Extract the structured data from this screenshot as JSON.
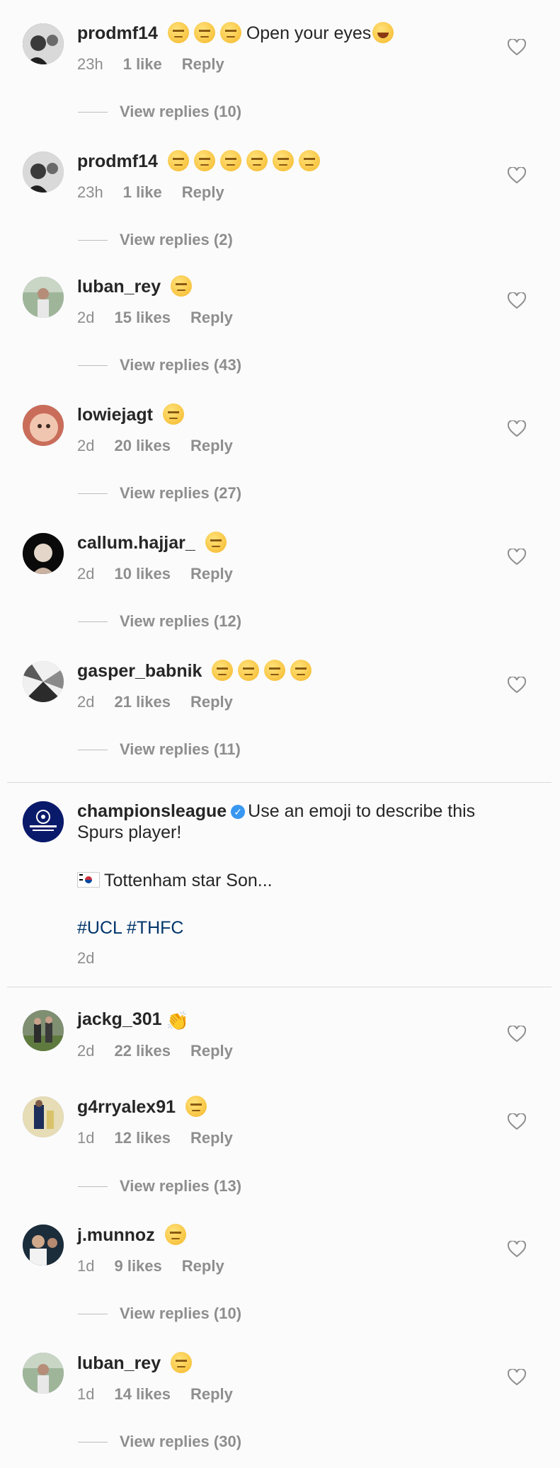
{
  "comments_top": [
    {
      "username": "prodmf14",
      "text": "Open your eyes",
      "emoji_count": 3,
      "extra": "laugh",
      "time": "23h",
      "likes": "1 like",
      "reply": "Reply",
      "view_replies": "View replies (10)"
    },
    {
      "username": "prodmf14",
      "text": "",
      "emoji_count": 6,
      "extra": "",
      "time": "23h",
      "likes": "1 like",
      "reply": "Reply",
      "view_replies": "View replies (2)"
    },
    {
      "username": "luban_rey",
      "text": "",
      "emoji_count": 1,
      "extra": "",
      "time": "2d",
      "likes": "15 likes",
      "reply": "Reply",
      "view_replies": "View replies (43)"
    },
    {
      "username": "lowiejagt",
      "text": "",
      "emoji_count": 1,
      "extra": "",
      "time": "2d",
      "likes": "20 likes",
      "reply": "Reply",
      "view_replies": "View replies (27)"
    },
    {
      "username": "callum.hajjar_",
      "text": "",
      "emoji_count": 1,
      "extra": "",
      "time": "2d",
      "likes": "10 likes",
      "reply": "Reply",
      "view_replies": "View replies (12)"
    },
    {
      "username": "gasper_babnik",
      "text": "",
      "emoji_count": 4,
      "extra": "",
      "time": "2d",
      "likes": "21 likes",
      "reply": "Reply",
      "view_replies": "View replies (11)"
    }
  ],
  "post": {
    "username": "championsleague",
    "caption_line1": "Use an emoji to describe this",
    "caption_line2": "Spurs player!",
    "caption_line3": "Tottenham star Son...",
    "hashtags": "#UCL #THFC",
    "time": "2d",
    "avatar_text": "CHAMPIONS LEAGUE"
  },
  "comments_bottom": [
    {
      "username": "jackg_301",
      "emoji": "clap",
      "emoji_count": 0,
      "time": "2d",
      "likes": "22 likes",
      "reply": "Reply",
      "view_replies": ""
    },
    {
      "username": "g4rryalex91",
      "emoji": "",
      "emoji_count": 1,
      "time": "1d",
      "likes": "12 likes",
      "reply": "Reply",
      "view_replies": "View replies (13)"
    },
    {
      "username": "j.munnoz",
      "emoji": "",
      "emoji_count": 1,
      "time": "1d",
      "likes": "9 likes",
      "reply": "Reply",
      "view_replies": "View replies (10)"
    },
    {
      "username": "luban_rey",
      "emoji": "",
      "emoji_count": 1,
      "time": "1d",
      "likes": "14 likes",
      "reply": "Reply",
      "view_replies": "View replies (30)"
    }
  ],
  "icons": {
    "heart": "heart-outline-icon",
    "verified": "verified-badge-icon"
  },
  "colors": {
    "username": "#262626",
    "meta": "#8e8e8e",
    "hashtag": "#003569",
    "verified": "#3897f0",
    "divider": "#dbdbdb"
  }
}
